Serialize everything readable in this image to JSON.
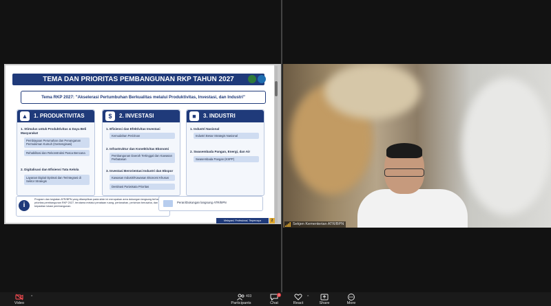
{
  "slide": {
    "title": "TEMA DAN PRIORITAS PEMBANGUNAN RKP TAHUN 2027",
    "theme": "Tema RKP 2027: \"Akselerasi Pertumbuhan Berkualitas melalui Produktivitas, Investasi, dan Industri\"",
    "columns": [
      {
        "heading": "1. PRODUKTIVITAS",
        "items": [
          {
            "label": "1. Stimulus untuk Produktivitas & Daya Beli Masyarakat",
            "chips": [
              "Pembiayaan Perumahan dan Penanganan Permukiman Kumuh (Gentengisasi)",
              "Rehabilitasi dan Rekonstruksi Pasca Bencana"
            ]
          },
          {
            "label": "2. Digitalisasi dan Efisiensi Tata Kelola",
            "chips": [
              "Layanan Digital Optimal dan Terintegrasi di Sektor Strategis"
            ]
          }
        ]
      },
      {
        "heading": "2. INVESTASI",
        "items": [
          {
            "label": "1. Efisiensi dan Efektivitas Investasi",
            "chips": [
              "Kemudahan Perizinan"
            ]
          },
          {
            "label": "2. Infrastruktur dan Konektivitas Ekonomi",
            "chips": [
              "Pembangunan Daerah Tertinggal dan Kawasan Perbatasan"
            ]
          },
          {
            "label": "3. Investasi Berorientasi Industri dan Ekspor",
            "chips": [
              "Kawasan Industri/Kawasan Ekonomi Khusus",
              "Destinasi Pariwisata Prioritas"
            ]
          }
        ]
      },
      {
        "heading": "3. INDUSTRI",
        "items": [
          {
            "label": "1. Industri Nasional",
            "chips": [
              "Industri Besar Strategis Nasional"
            ]
          },
          {
            "label": "2. Swasembada Pangan, Energi, dan Air",
            "chips": [
              "Swasembada Pangan (KSPP)"
            ]
          }
        ]
      }
    ],
    "note": "Program dan kegiatan ATR/BPN yang ditampilkan pada slide ini merupakan area dukungan langsung terhadap prioritas pembangunan RKP 2027, terutama melalui penataan ruang, pertanahan, perizinan berusaha, dan kepastian lokasi pembangunan.",
    "legend": "Peran/Dukungan langsung ATR/BPN",
    "footer": "Melayani, Profesional, Terpercaya",
    "page_number": "2"
  },
  "video": {
    "participant_name": "Sekjen Kementerian ATR/BPN"
  },
  "toolbar": {
    "video_label": "Video",
    "participants_label": "Participants",
    "participants_count": "403",
    "chat_label": "Chat",
    "chat_badge": "4",
    "react_label": "React",
    "share_label": "Share",
    "more_label": "More"
  },
  "colors": {
    "slide_navy": "#1f3a7a",
    "chip_blue": "#cfdcf1",
    "video_off_red": "#e5484d"
  }
}
